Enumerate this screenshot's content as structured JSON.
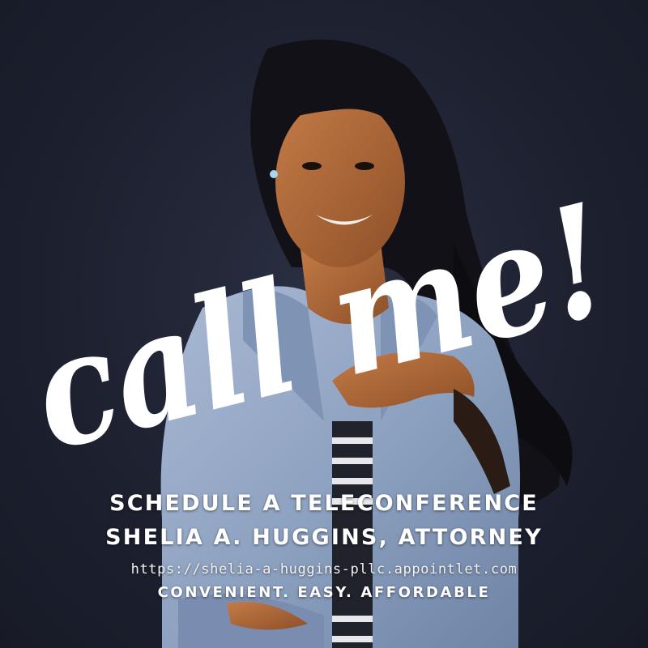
{
  "headline": "call me!",
  "schedule_line": "SCHEDULE A TELECONFERENCE",
  "name_line": "SHELIA A. HUGGINS, ATTORNEY",
  "url": "https://shelia-a-huggins-pllc.appointlet.com",
  "tagline": "CONVENIENT. EASY. AFFORDABLE",
  "colors": {
    "background": "#1e2232",
    "text": "#ffffff",
    "denim": "#8fa3c2",
    "skin": "#b06a3c",
    "hair": "#111015"
  }
}
